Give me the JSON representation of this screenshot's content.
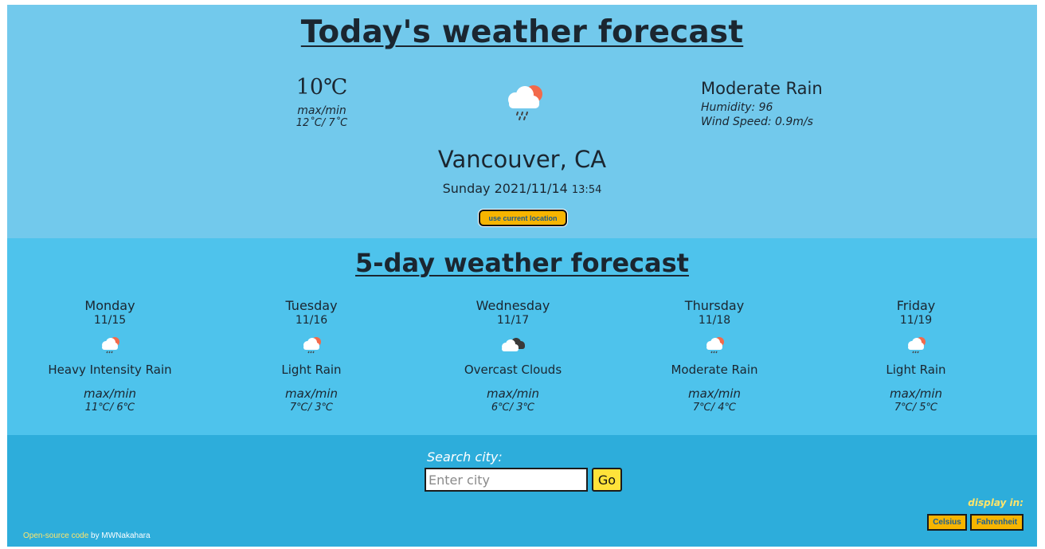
{
  "today": {
    "title": "Today's weather forecast",
    "temperature": "10℃",
    "maxmin_label": "max/min",
    "maxmin_value": "12˚C/ 7˚C",
    "icon": "rain-cloud-sun-icon",
    "description": "Moderate Rain",
    "humidity": "Humidity: 96",
    "wind": "Wind Speed: 0.9m/s",
    "city": "Vancouver, CA",
    "date": "Sunday 2021/11/14",
    "time": "13:54",
    "location_button": "use current location"
  },
  "forecast": {
    "title": "5-day weather forecast",
    "maxmin_label": "max/min",
    "days": [
      {
        "name": "Monday",
        "date": "11/15",
        "icon": "rain-cloud-sun-icon",
        "description": "Heavy Intensity Rain",
        "maxmin": "11℃/ 6℃"
      },
      {
        "name": "Tuesday",
        "date": "11/16",
        "icon": "rain-cloud-sun-icon",
        "description": "Light Rain",
        "maxmin": "7℃/ 3℃"
      },
      {
        "name": "Wednesday",
        "date": "11/17",
        "icon": "overcast-clouds-icon",
        "description": "Overcast Clouds",
        "maxmin": "6℃/ 3℃"
      },
      {
        "name": "Thursday",
        "date": "11/18",
        "icon": "rain-cloud-sun-icon",
        "description": "Moderate Rain",
        "maxmin": "7℃/ 4℃"
      },
      {
        "name": "Friday",
        "date": "11/19",
        "icon": "rain-cloud-sun-icon",
        "description": "Light Rain",
        "maxmin": "7℃/ 5℃"
      }
    ]
  },
  "search": {
    "label": "Search city:",
    "placeholder": "Enter city",
    "value": "",
    "button": "Go"
  },
  "units": {
    "label": "display in:",
    "celsius": "Celsius",
    "fahrenheit": "Fahrenheit"
  },
  "footer": {
    "link_text": "Open-source code",
    "by_text": " by MWNakahara"
  },
  "colors": {
    "today_bg": "#72c9ec",
    "forecast_bg": "#4ec3ec",
    "bottom_bg": "#2daddb",
    "accent_button": "#f7b500",
    "go_button": "#ffe23a"
  }
}
